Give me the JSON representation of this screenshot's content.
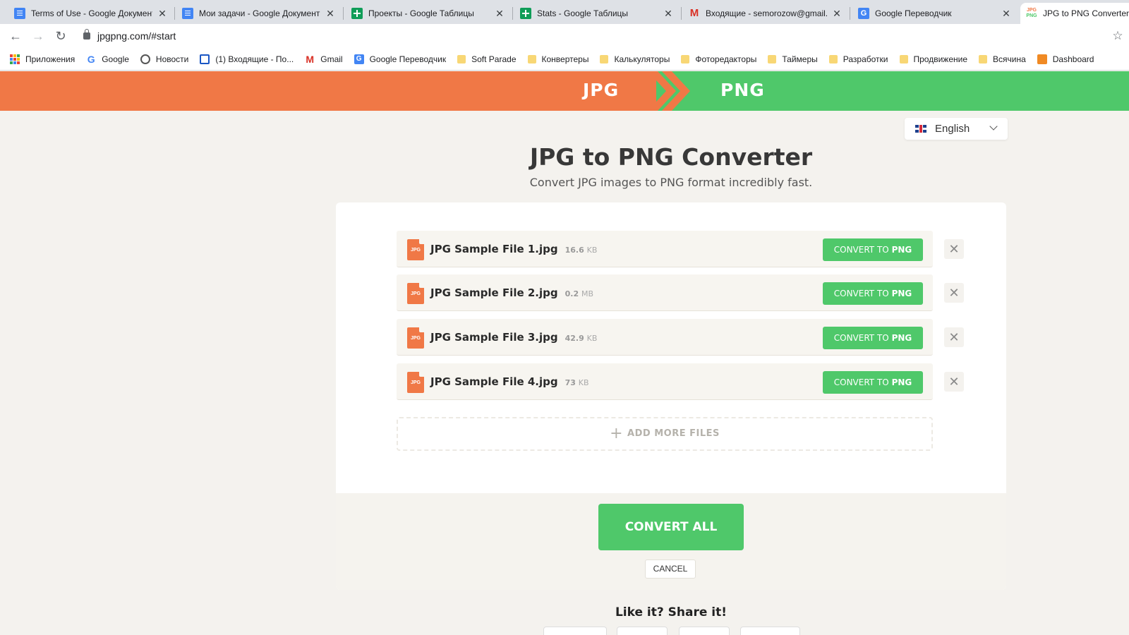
{
  "browser": {
    "tabs": [
      {
        "title": "Terms of Use - Google Документы",
        "favicon": "google-docs-icon"
      },
      {
        "title": "Мои задачи - Google Документы",
        "favicon": "google-docs-icon"
      },
      {
        "title": "Проекты - Google Таблицы",
        "favicon": "google-sheets-icon"
      },
      {
        "title": "Stats - Google Таблицы",
        "favicon": "google-sheets-icon"
      },
      {
        "title": "Входящие - semorozow@gmail.com",
        "favicon": "gmail-icon"
      },
      {
        "title": "Google Переводчик",
        "favicon": "google-translate-icon"
      },
      {
        "title": "JPG to PNG Converter",
        "favicon": "jpgpng-icon"
      }
    ],
    "url": "jpgpng.com/#start",
    "bookmarks": [
      {
        "label": "Приложения",
        "icon": "apps-icon"
      },
      {
        "label": "Google",
        "icon": "google-icon"
      },
      {
        "label": "Новости",
        "icon": "globe-icon"
      },
      {
        "label": "(1) Входящие - По...",
        "icon": "mail-icon"
      },
      {
        "label": "Gmail",
        "icon": "gmail-icon"
      },
      {
        "label": "Google Переводчик",
        "icon": "google-translate-icon"
      },
      {
        "label": "Soft Parade",
        "icon": "folder-icon"
      },
      {
        "label": "Конвертеры",
        "icon": "folder-icon"
      },
      {
        "label": "Калькуляторы",
        "icon": "folder-icon"
      },
      {
        "label": "Фоторедакторы",
        "icon": "folder-icon"
      },
      {
        "label": "Таймеры",
        "icon": "folder-icon"
      },
      {
        "label": "Разработки",
        "icon": "folder-icon"
      },
      {
        "label": "Продвижение",
        "icon": "folder-icon"
      },
      {
        "label": "Всячина",
        "icon": "folder-icon"
      },
      {
        "label": "Dashboard",
        "icon": "dashboard-icon"
      }
    ]
  },
  "header": {
    "from_format": "JPG",
    "to_format": "PNG",
    "jpg_color": "#f07846",
    "png_color": "#4fc86a"
  },
  "language": {
    "selected": "English"
  },
  "page": {
    "title": "JPG to PNG Converter",
    "subtitle": "Convert JPG images to PNG format incredibly fast."
  },
  "files": [
    {
      "name": "JPG Sample File 1.jpg",
      "size": "16.6",
      "unit": "KB"
    },
    {
      "name": "JPG Sample File 2.jpg",
      "size": "0.2",
      "unit": "MB"
    },
    {
      "name": "JPG Sample File 3.jpg",
      "size": "42.9",
      "unit": "KB"
    },
    {
      "name": "JPG Sample File 4.jpg",
      "size": "73",
      "unit": "KB"
    }
  ],
  "file_icon_label": "JPG",
  "convert_button": {
    "prefix": "CONVERT TO",
    "target": "PNG"
  },
  "add_more_label": "ADD MORE FILES",
  "convert_all_label": "CONVERT ALL",
  "cancel_label": "CANCEL",
  "share_title": "Like it? Share it!"
}
